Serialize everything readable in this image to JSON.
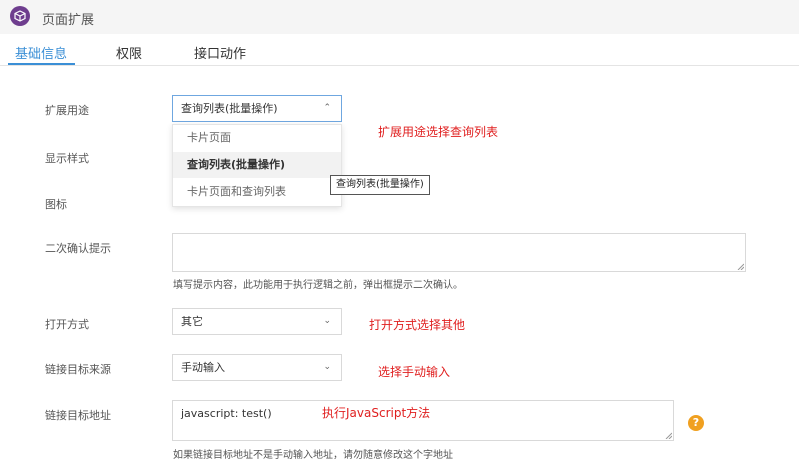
{
  "header": {
    "title": "页面扩展",
    "logo_icon": "cube-icon"
  },
  "tabs": [
    {
      "label": "基础信息",
      "active": true
    },
    {
      "label": "权限",
      "active": false
    },
    {
      "label": "接口动作",
      "active": false
    }
  ],
  "form": {
    "extension_use": {
      "label": "扩展用途",
      "value": "查询列表(批量操作)"
    },
    "display_style": {
      "label": "显示样式"
    },
    "icon": {
      "label": "图标"
    },
    "confirm_prompt": {
      "label": "二次确认提示",
      "value": "",
      "hint": "填写提示内容，此功能用于执行逻辑之前，弹出框提示二次确认。"
    },
    "open_mode": {
      "label": "打开方式",
      "value": "其它"
    },
    "link_source": {
      "label": "链接目标来源",
      "value": "手动输入"
    },
    "link_url": {
      "label": "链接目标地址",
      "value": "javascript: test()",
      "hint": "如果链接目标地址不是手动输入地址，请勿随意修改这个字地址"
    }
  },
  "dropdown": {
    "options": [
      "卡片页面",
      "查询列表(批量操作)",
      "卡片页面和查询列表"
    ],
    "selected_index": 1,
    "tooltip": "查询列表(批量操作)"
  },
  "annotations": {
    "extension_use": "扩展用途选择查询列表",
    "open_mode": "打开方式选择其他",
    "link_source": "选择手动输入",
    "link_url": "执行JavaScript方法"
  },
  "colors": {
    "accent": "#3b8fd6",
    "annotation": "#e02020",
    "logo": "#6e3d8e",
    "help": "#f0a020"
  }
}
